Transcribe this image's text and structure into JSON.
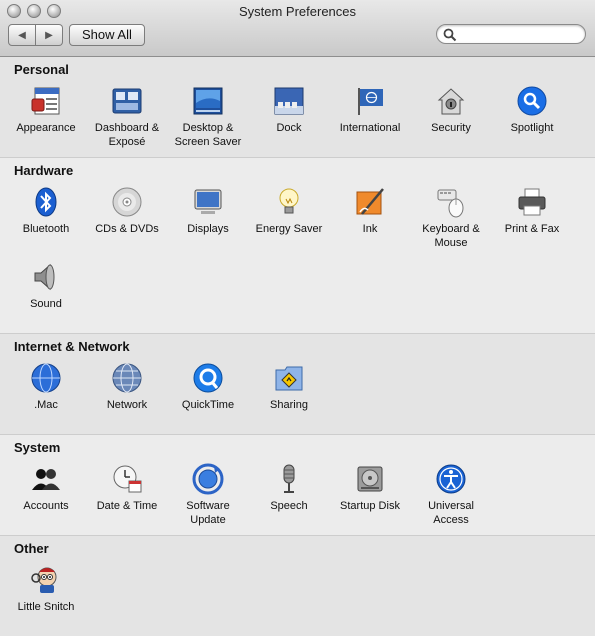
{
  "window": {
    "title": "System Preferences"
  },
  "toolbar": {
    "back_glyph": "◀",
    "forward_glyph": "▶",
    "show_all_label": "Show All",
    "search": {
      "placeholder": "",
      "value": ""
    }
  },
  "sections": [
    {
      "title": "Personal",
      "items": [
        {
          "label": "Appearance",
          "icon": "appearance-icon"
        },
        {
          "label": "Dashboard & Exposé",
          "icon": "dashboard-icon"
        },
        {
          "label": "Desktop & Screen Saver",
          "icon": "desktop-icon"
        },
        {
          "label": "Dock",
          "icon": "dock-icon"
        },
        {
          "label": "International",
          "icon": "flag-icon"
        },
        {
          "label": "Security",
          "icon": "house-lock-icon"
        },
        {
          "label": "Spotlight",
          "icon": "spotlight-icon"
        }
      ]
    },
    {
      "title": "Hardware",
      "items": [
        {
          "label": "Bluetooth",
          "icon": "bluetooth-icon"
        },
        {
          "label": "CDs & DVDs",
          "icon": "disc-icon"
        },
        {
          "label": "Displays",
          "icon": "display-icon"
        },
        {
          "label": "Energy Saver",
          "icon": "lightbulb-icon"
        },
        {
          "label": "Ink",
          "icon": "ink-icon"
        },
        {
          "label": "Keyboard & Mouse",
          "icon": "keyboard-mouse-icon"
        },
        {
          "label": "Print & Fax",
          "icon": "printer-icon"
        },
        {
          "label": "Sound",
          "icon": "speaker-icon"
        }
      ]
    },
    {
      "title": "Internet & Network",
      "items": [
        {
          "label": ".Mac",
          "icon": "globe-icon"
        },
        {
          "label": "Network",
          "icon": "network-icon"
        },
        {
          "label": "QuickTime",
          "icon": "quicktime-icon"
        },
        {
          "label": "Sharing",
          "icon": "sharing-folder-icon"
        }
      ]
    },
    {
      "title": "System",
      "items": [
        {
          "label": "Accounts",
          "icon": "accounts-icon"
        },
        {
          "label": "Date & Time",
          "icon": "clock-icon"
        },
        {
          "label": "Software Update",
          "icon": "software-update-icon"
        },
        {
          "label": "Speech",
          "icon": "microphone-icon"
        },
        {
          "label": "Startup Disk",
          "icon": "hard-disk-icon"
        },
        {
          "label": "Universal Access",
          "icon": "universal-access-icon"
        }
      ]
    },
    {
      "title": "Other",
      "items": [
        {
          "label": "Little Snitch",
          "icon": "little-snitch-icon"
        }
      ]
    }
  ],
  "colors": {
    "window_bg": "#ececec",
    "alt_section_bg": "#e4e4e4",
    "accent_blue": "#1a6ee6"
  }
}
